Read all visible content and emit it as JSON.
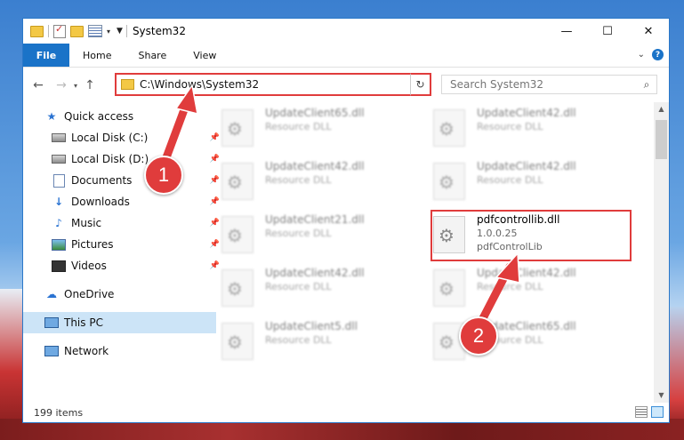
{
  "window": {
    "title": "System32"
  },
  "controls": {
    "minimize": "—",
    "maximize": "☐",
    "close": "✕"
  },
  "ribbon": {
    "tabs": [
      {
        "label": "File"
      },
      {
        "label": "Home"
      },
      {
        "label": "Share"
      },
      {
        "label": "View"
      }
    ],
    "help": "?"
  },
  "address": {
    "path": "C:\\Windows\\System32"
  },
  "search": {
    "placeholder": "Search System32"
  },
  "nav": {
    "items": [
      {
        "label": "Quick access",
        "icon": "star-icon"
      },
      {
        "label": "Local Disk (C:)",
        "icon": "disk-icon"
      },
      {
        "label": "Local Disk (D:)",
        "icon": "disk-icon"
      },
      {
        "label": "Documents",
        "icon": "documents-icon"
      },
      {
        "label": "Downloads",
        "icon": "downloads-icon"
      },
      {
        "label": "Music",
        "icon": "music-icon"
      },
      {
        "label": "Pictures",
        "icon": "pictures-icon"
      },
      {
        "label": "Videos",
        "icon": "videos-icon"
      },
      {
        "label": "OneDrive",
        "icon": "cloud-icon"
      },
      {
        "label": "This PC",
        "icon": "pc-icon",
        "selected": true
      },
      {
        "label": "Network",
        "icon": "network-icon"
      }
    ]
  },
  "files": [
    {
      "name": "UpdateClient65.dll",
      "desc": "Resource DLL"
    },
    {
      "name": "UpdateClient42.dll",
      "desc": "Resource DLL"
    },
    {
      "name": "UpdateClient42.dll",
      "desc": "Resource DLL"
    },
    {
      "name": "UpdateClient42.dll",
      "desc": "Resource DLL"
    },
    {
      "name": "UpdateClient21.dll",
      "desc": "Resource DLL"
    },
    {
      "name": "pdfcontrollib.dll",
      "version": "1.0.0.25",
      "desc": "pdfControlLib"
    },
    {
      "name": "UpdateClient42.dll",
      "desc": "Resource DLL"
    },
    {
      "name": "UpdateClient42.dll",
      "desc": "Resource DLL"
    },
    {
      "name": "UpdateClient5.dll",
      "desc": "Resource DLL"
    },
    {
      "name": "UpdateClient65.dll",
      "desc": "Resource DLL"
    }
  ],
  "status": {
    "items": "199 items"
  },
  "callouts": {
    "one": "1",
    "two": "2"
  },
  "colors": {
    "accent": "#1a73c8",
    "highlight": "#e03c3c"
  }
}
